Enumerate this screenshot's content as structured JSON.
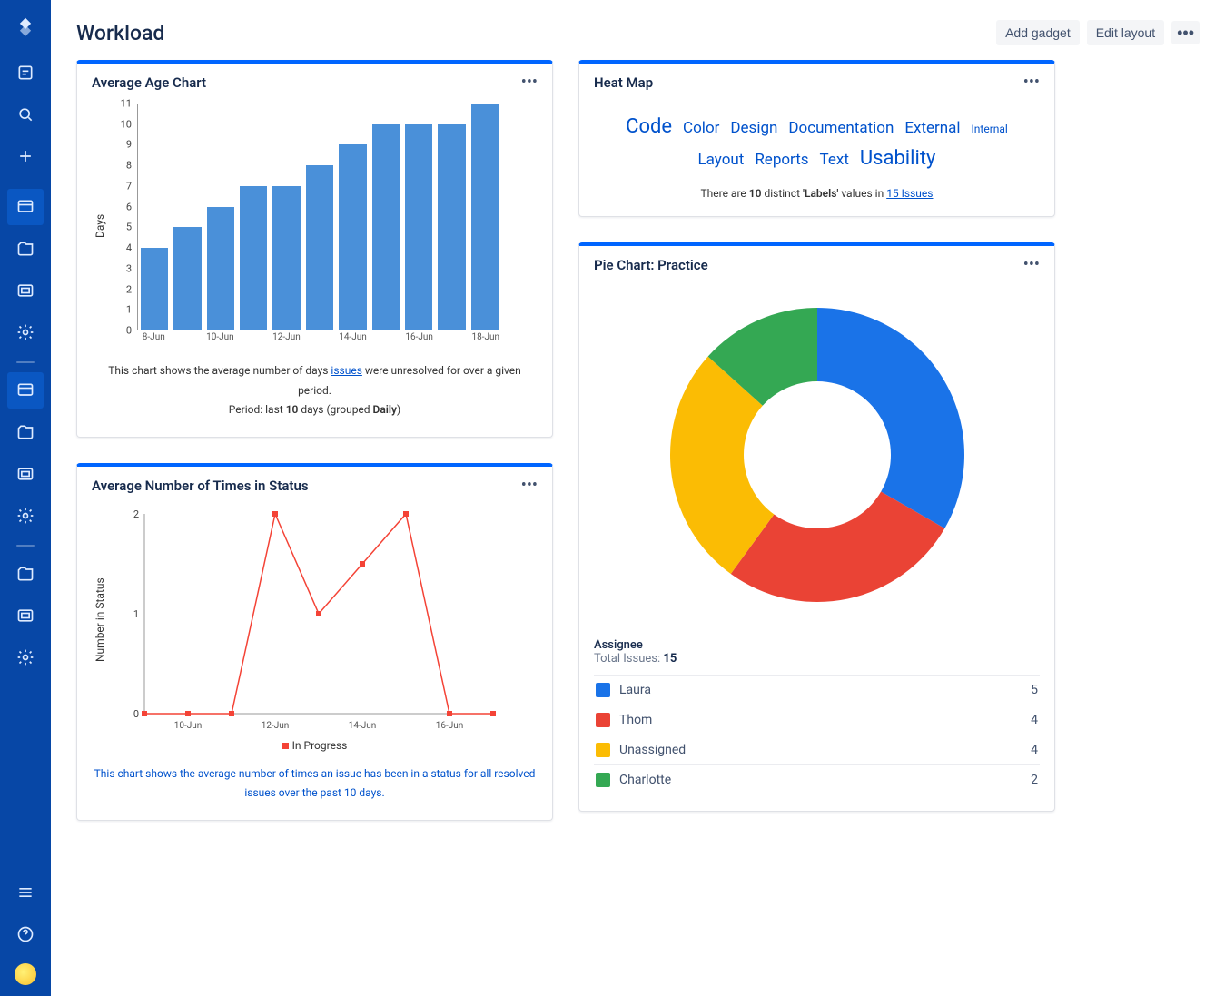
{
  "page": {
    "title": "Workload"
  },
  "header": {
    "add_gadget": "Add gadget",
    "edit_layout": "Edit layout"
  },
  "gadgets": {
    "age": {
      "title": "Average Age Chart",
      "caption_pre": "This chart shows the average number of days ",
      "caption_link": "issues",
      "caption_post": " were unresolved for over a given period.",
      "caption2_pre": "Period: last ",
      "caption2_days": "10",
      "caption2_mid": " days (grouped ",
      "caption2_group": "Daily",
      "caption2_post": ")"
    },
    "status": {
      "title": "Average Number of Times in Status",
      "legend": "In Progress",
      "caption": "This chart shows the average number of times an issue has been in a status for all resolved issues over the past 10 days."
    },
    "heat": {
      "title": "Heat Map",
      "words": {
        "code": "Code",
        "color": "Color",
        "design": "Design",
        "documentation": "Documentation",
        "external": "External",
        "internal": "Internal",
        "layout": "Layout",
        "reports": "Reports",
        "text": "Text",
        "usability": "Usability"
      },
      "caption_pre": "There are ",
      "caption_n": "10",
      "caption_mid": " distinct ",
      "caption_field": "'Labels'",
      "caption_mid2": " values in ",
      "caption_link": "15 Issues"
    },
    "pie": {
      "title": "Pie Chart: Practice",
      "legend_title": "Assignee",
      "total_label": "Total Issues: ",
      "total": "15",
      "rows": [
        {
          "label": "Laura",
          "value": "5",
          "color": "#1a73e8"
        },
        {
          "label": "Thom",
          "value": "4",
          "color": "#ea4335"
        },
        {
          "label": "Unassigned",
          "value": "4",
          "color": "#fbbc04"
        },
        {
          "label": "Charlotte",
          "value": "2",
          "color": "#34a853"
        }
      ]
    }
  },
  "chart_data": [
    {
      "id": "age",
      "type": "bar",
      "title": "Average Age Chart",
      "xlabel": "",
      "ylabel": "Days",
      "ylim": [
        0,
        11
      ],
      "categories": [
        "8-Jun",
        "9-Jun",
        "10-Jun",
        "11-Jun",
        "12-Jun",
        "13-Jun",
        "14-Jun",
        "15-Jun",
        "16-Jun",
        "17-Jun",
        "18-Jun"
      ],
      "x_tick_labels": [
        "8-Jun",
        "",
        "10-Jun",
        "",
        "12-Jun",
        "",
        "14-Jun",
        "",
        "16-Jun",
        "",
        "18-Jun"
      ],
      "values": [
        4,
        5,
        6,
        7,
        7,
        8,
        9,
        10,
        10,
        10,
        11
      ],
      "colors": {
        "bar": "#4a90d9"
      }
    },
    {
      "id": "status",
      "type": "line",
      "title": "Average Number of Times in Status",
      "xlabel": "",
      "ylabel": "Number in Status",
      "ylim": [
        0,
        2
      ],
      "categories": [
        "9-Jun",
        "10-Jun",
        "11-Jun",
        "12-Jun",
        "13-Jun",
        "14-Jun",
        "15-Jun",
        "16-Jun",
        "17-Jun"
      ],
      "x_tick_labels": [
        "",
        "10-Jun",
        "",
        "12-Jun",
        "",
        "14-Jun",
        "",
        "16-Jun",
        ""
      ],
      "series": [
        {
          "name": "In Progress",
          "values": [
            0,
            0,
            0,
            2,
            1,
            1.5,
            2,
            0,
            0
          ],
          "color": "#f44336"
        }
      ]
    },
    {
      "id": "heat",
      "type": "heatmap",
      "title": "Heat Map",
      "field": "Labels",
      "distinct": 10,
      "issue_count": 15,
      "tags": [
        {
          "label": "Code",
          "weight": 4
        },
        {
          "label": "Color",
          "weight": 2
        },
        {
          "label": "Design",
          "weight": 2
        },
        {
          "label": "Documentation",
          "weight": 2
        },
        {
          "label": "External",
          "weight": 2
        },
        {
          "label": "Internal",
          "weight": 1
        },
        {
          "label": "Layout",
          "weight": 2
        },
        {
          "label": "Reports",
          "weight": 2
        },
        {
          "label": "Text",
          "weight": 2
        },
        {
          "label": "Usability",
          "weight": 4
        }
      ]
    },
    {
      "id": "pie",
      "type": "pie",
      "title": "Pie Chart: Practice",
      "category_label": "Assignee",
      "total": 15,
      "series": [
        {
          "name": "Laura",
          "value": 5,
          "color": "#1a73e8"
        },
        {
          "name": "Thom",
          "value": 4,
          "color": "#ea4335"
        },
        {
          "name": "Unassigned",
          "value": 4,
          "color": "#fbbc04"
        },
        {
          "name": "Charlotte",
          "value": 2,
          "color": "#34a853"
        }
      ]
    }
  ]
}
